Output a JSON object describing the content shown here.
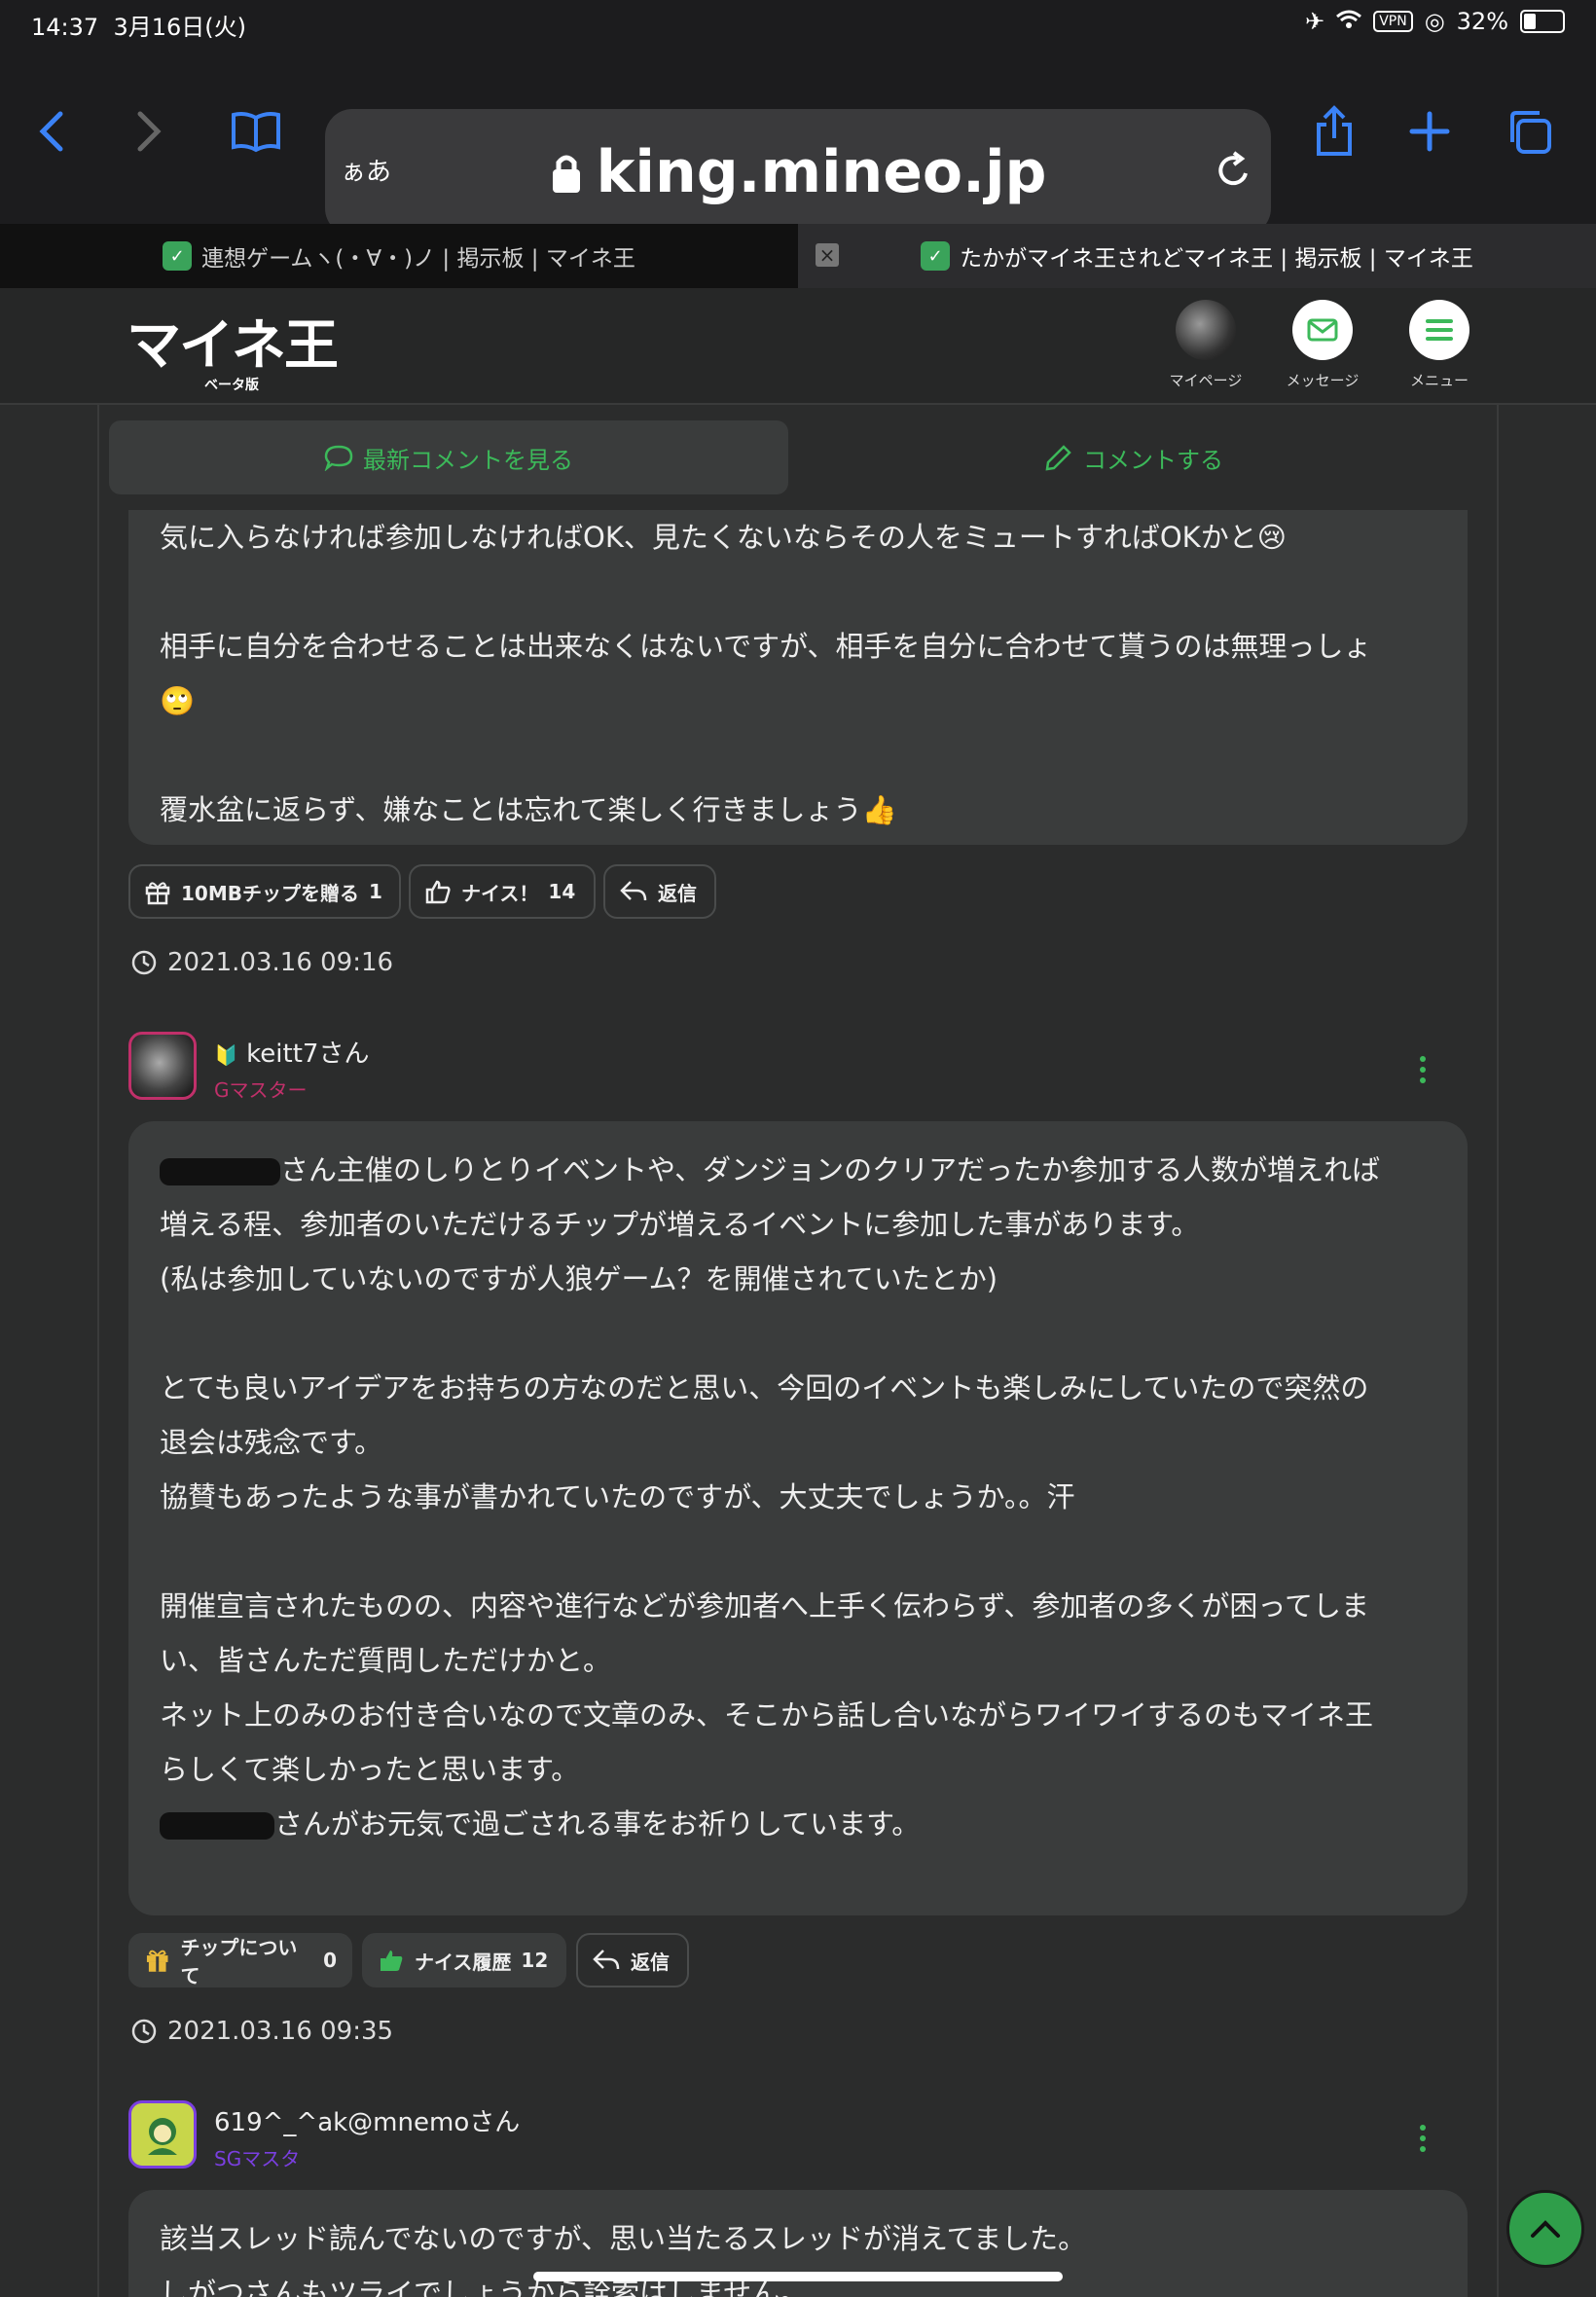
{
  "statusbar": {
    "time": "14:37",
    "date": "3月16日(火)",
    "vpn": "VPN",
    "battery": "32%",
    "battery_level": 0.32
  },
  "browser": {
    "text_size": "ぁあ",
    "url": "king.mineo.jp",
    "tabs": [
      {
        "title": "連想ゲームヽ(・∀・)ノ | 掲示板 | マイネ王"
      },
      {
        "title": "たかがマイネ王されどマイネ王 | 掲示板 | マイネ王"
      }
    ]
  },
  "site": {
    "logo": "マイネ王",
    "beta": "ベータ版",
    "nav": {
      "mypage": "マイページ",
      "message": "メッセージ",
      "menu": "メニュー"
    }
  },
  "actions": {
    "latest": "最新コメントを見る",
    "comment": "コメントする"
  },
  "comments": [
    {
      "body": "気に入らなければ参加しなければOK、見たくないならその人をミュートすればOKかと😢\n\n相手に自分を合わせることは出来なくはないですが、相手を自分に合わせて貰うのは無理っしょ\n🙄\n\n覆水盆に返らず、嫌なことは忘れて楽しく行きましょう👍",
      "buttons": {
        "tip": "10MBチップを贈る",
        "tip_count": "1",
        "nice": "ナイス！",
        "nice_count": "14",
        "reply": "返信"
      },
      "date": "2021.03.16 09:16"
    },
    {
      "user": "keitt7さん",
      "rank": "Gマスター",
      "body_line1": "さん主催のしりとりイベントや、ダンジョンのクリアだったか参加する人数が増えれば",
      "body_mid": "増える程、参加者のいただけるチップが増えるイベントに参加した事があります。\n(私は参加していないのですが人狼ゲーム？を開催されていたとか)\n\nとても良いアイデアをお持ちの方なのだと思い、今回のイベントも楽しみにしていたので突然の\n退会は残念です。\n協賛もあったような事が書かれていたのですが、大丈夫でしょうか。。汗\n\n開催宣言されたものの、内容や進行などが参加者へ上手く伝わらず、参加者の多くが困ってしま\nい、皆さんただ質問しただけかと。\nネット上のみのお付き合いなので文章のみ、そこから話し合いながらワイワイするのもマイネ王\nらしくて楽しかったと思います。\n",
      "body_last": "さんがお元気で過ごされる事をお祈りしています。",
      "buttons": {
        "tip": "チップについて",
        "tip_count": "0",
        "nice": "ナイス履歴",
        "nice_count": "12",
        "reply": "返信"
      },
      "date": "2021.03.16 09:35"
    },
    {
      "user": "619^_^ak@mnemoさん",
      "rank": "SGマスタ",
      "body": "該当スレッド読んでないのですが、思い当たるスレッドが消えてました。\nしがつさんもツライでしょうから詮索はしません。"
    }
  ],
  "colors": {
    "accent": "#3cb95a",
    "gold_rank": "#c0306a",
    "sg_rank": "#7a3fe0"
  }
}
